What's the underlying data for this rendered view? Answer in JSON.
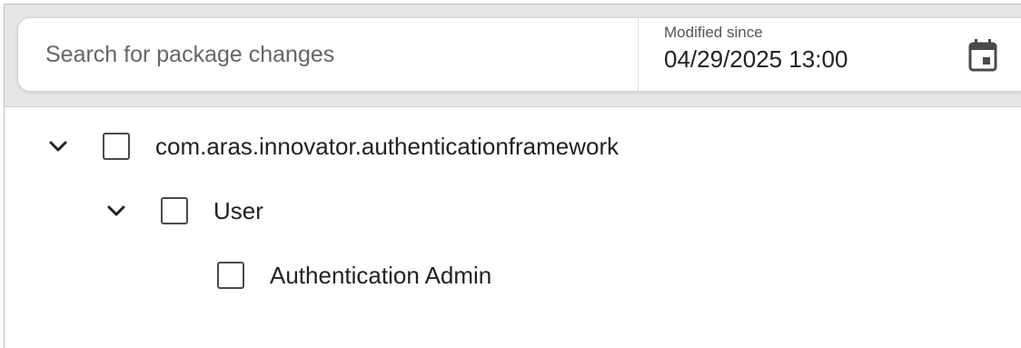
{
  "search": {
    "placeholder": "Search for package changes",
    "value": ""
  },
  "date_filter": {
    "label": "Modified since",
    "value": "04/29/2025 13:00",
    "icon": "calendar-icon"
  },
  "tree": {
    "nodes": [
      {
        "label": "com.aras.innovator.authenticationframework",
        "level": 0,
        "expanded": true,
        "checked": false
      },
      {
        "label": "User",
        "level": 1,
        "expanded": true,
        "checked": false
      },
      {
        "label": "Authentication Admin",
        "level": 2,
        "expanded": false,
        "checked": false
      }
    ]
  },
  "colors": {
    "toolbar_background": "#e6e6e6",
    "text": "#222222",
    "placeholder": "#666666",
    "checkbox_border": "#4a4a4a"
  }
}
